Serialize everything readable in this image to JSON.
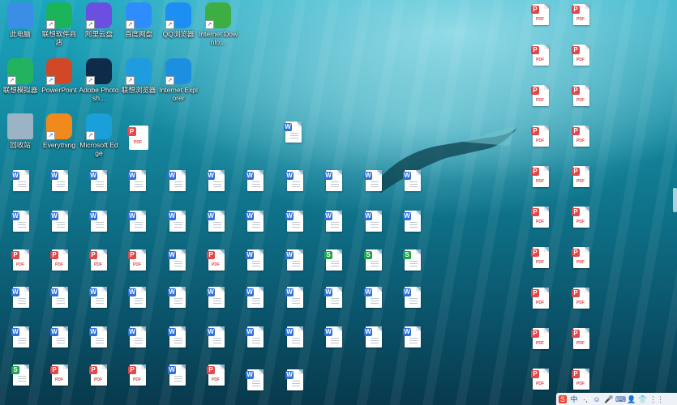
{
  "desktop_icons": [
    {
      "label": "此电脑",
      "icon": "computer-icon",
      "color": "#3a8ee6"
    },
    {
      "label": "联想软件商店",
      "icon": "lenovo-store-icon",
      "color": "#1bb35a"
    },
    {
      "label": "阿里云盘",
      "icon": "aliyun-drive-icon",
      "color": "#6a4fe0"
    },
    {
      "label": "百度网盘",
      "icon": "baidu-netdisk-icon",
      "color": "#2f8cff"
    },
    {
      "label": "QQ浏览器",
      "icon": "qq-browser-icon",
      "color": "#1e8ff2"
    },
    {
      "label": "Internet Downlo...",
      "icon": "internet-download-manager-icon",
      "color": "#3fae42"
    },
    {
      "label": "联想模拟器",
      "icon": "lenovo-emulator-icon",
      "color": "#23b35f"
    },
    {
      "label": "PowerPoint",
      "icon": "powerpoint-icon",
      "color": "#d24726"
    },
    {
      "label": "Adobe Photosh...",
      "icon": "photoshop-icon",
      "color": "#0f2b4a"
    },
    {
      "label": "联想浏览器",
      "icon": "lenovo-browser-icon",
      "color": "#1f9be0"
    },
    {
      "label": "Internet Explorer",
      "icon": "internet-explorer-icon",
      "color": "#1d8fe0"
    },
    {
      "label": "回收站",
      "icon": "recycle-bin-icon",
      "color": "#9bb3c4"
    },
    {
      "label": "Everything",
      "icon": "everything-search-icon",
      "color": "#f08a1c"
    },
    {
      "label": "Microsoft Edge",
      "icon": "edge-icon",
      "color": "#1aa0d8"
    },
    {
      "label": "",
      "icon": "pdf-file-icon",
      "color": "#e0484a"
    }
  ],
  "file_glyphs": {
    "w": "W",
    "p": "P",
    "s": "S"
  },
  "pdf_text": "PDF",
  "file_grid": {
    "rows": [
      [
        "w",
        "w",
        "w",
        "w",
        "w",
        "w",
        "w",
        "w",
        "w",
        "w",
        "w"
      ],
      [
        "w",
        "w",
        "w",
        "w",
        "w",
        "w",
        "w",
        "w",
        "w",
        "w",
        "w"
      ],
      [
        "p",
        "p",
        "p",
        "p",
        "w",
        "p",
        "w",
        "w",
        "s",
        "s",
        "s"
      ],
      [
        "w",
        "w",
        "w",
        "w",
        "w",
        "w",
        "w",
        "w",
        "w",
        "w",
        "w"
      ],
      [
        "w",
        "w",
        "w",
        "w",
        "w",
        "w",
        "w",
        "w",
        "w",
        "w",
        "w"
      ],
      [
        "s",
        "p",
        "p",
        "p",
        "w",
        "p",
        "w",
        "w"
      ]
    ],
    "extra_top": [
      "w"
    ]
  },
  "right_column": {
    "count": 10,
    "type": "p"
  },
  "taskbar": {
    "items": [
      {
        "icon": "sogou-ime-icon",
        "glyph": "S"
      },
      {
        "icon": "chinese-mode-icon",
        "glyph": "中"
      },
      {
        "icon": "punctuation-icon",
        "glyph": "·,"
      },
      {
        "icon": "emoji-icon",
        "glyph": "☺"
      },
      {
        "icon": "microphone-icon",
        "glyph": "🎤"
      },
      {
        "icon": "keyboard-icon",
        "glyph": "⌨"
      },
      {
        "icon": "user-icon",
        "glyph": "👤"
      },
      {
        "icon": "skin-icon",
        "glyph": "👕"
      },
      {
        "icon": "grid-menu-icon",
        "glyph": "⋮⋮"
      }
    ]
  }
}
